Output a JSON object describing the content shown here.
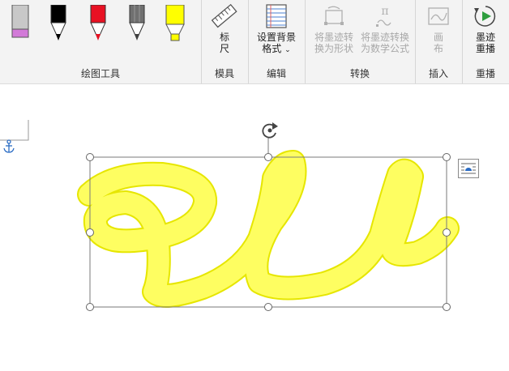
{
  "ribbon": {
    "groups": {
      "drawing_tools": {
        "label": "绘图工具"
      },
      "stencils": {
        "label": "模具",
        "ruler_label_line1": "标",
        "ruler_label_line2": "尺"
      },
      "edit": {
        "label": "编辑",
        "bg_format_line1": "设置背景",
        "bg_format_line2": "格式"
      },
      "convert": {
        "label": "转换",
        "ink_to_shape_line1": "将墨迹转",
        "ink_to_shape_line2": "换为形状",
        "ink_to_math_line1": "将墨迹转换",
        "ink_to_math_line2": "为数学公式"
      },
      "insert": {
        "label": "插入",
        "canvas_line1": "画",
        "canvas_line2": "布"
      },
      "replay": {
        "label": "重播",
        "ink_replay_line1": "墨迹",
        "ink_replay_line2": "重播"
      }
    },
    "pens": [
      {
        "name": "pencil-gray",
        "color": "#c8c8c8",
        "tip": "#d27ad8"
      },
      {
        "name": "pen-black",
        "color": "#000000",
        "tip": "#000000"
      },
      {
        "name": "pen-red",
        "color": "#e81123",
        "tip": "#e81123"
      },
      {
        "name": "pencil-dark",
        "color": "#707070",
        "tip": "#404040"
      },
      {
        "name": "highlighter-yellow",
        "color": "#ffff00",
        "tip": "#ffff00"
      }
    ]
  },
  "ink": {
    "stroke_color": "#ffff00",
    "outline_color": "#e6e600"
  },
  "selection": {
    "border_color": "#7a7a7a"
  },
  "icons": [
    "pencil-icon",
    "pen-icon",
    "highlighter-icon",
    "ruler-icon",
    "background-format-icon",
    "ink-to-shape-icon",
    "ink-to-math-icon",
    "canvas-icon",
    "ink-replay-icon",
    "anchor-icon",
    "rotate-icon",
    "layout-options-icon"
  ]
}
